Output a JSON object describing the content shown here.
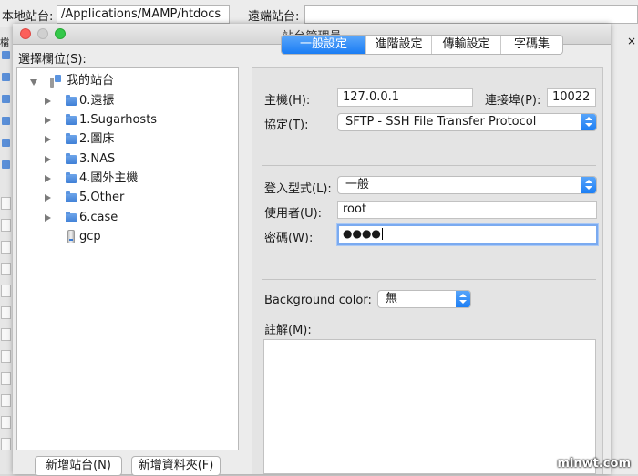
{
  "background": {
    "local_site_label": "本地站台:",
    "local_site_path": "/Applications/MAMP/htdocs",
    "remote_site_label": "遠端站台:",
    "remote_site_path": "",
    "left_cut_label": "檔",
    "right_close_glyph": "×"
  },
  "window": {
    "title": "站台管理員"
  },
  "site_selector": {
    "label": "選擇欄位(S):",
    "root": "我的站台",
    "folders": [
      "0.遠振",
      "1.Sugarhosts",
      "2.圖床",
      "3.NAS",
      "4.國外主機",
      "5.Other",
      "6.case"
    ],
    "site": "gcp",
    "new_site_button": "新增站台(N)",
    "new_folder_button": "新增資料夾(F)"
  },
  "tabs": [
    {
      "label": "一般設定",
      "active": true
    },
    {
      "label": "進階設定",
      "active": false
    },
    {
      "label": "傳輸設定",
      "active": false
    },
    {
      "label": "字碼集",
      "active": false
    }
  ],
  "general": {
    "host_label": "主機(H):",
    "host_value": "127.0.0.1",
    "port_label": "連接埠(P):",
    "port_value": "10022",
    "protocol_label": "協定(T):",
    "protocol_value": "SFTP - SSH File Transfer Protocol",
    "logon_type_label": "登入型式(L):",
    "logon_type_value": "一般",
    "user_label": "使用者(U):",
    "user_value": "root",
    "password_label": "密碼(W):",
    "password_masked": "●●●●",
    "bg_color_label": "Background color:",
    "bg_color_value": "無",
    "comments_label": "註解(M):"
  },
  "watermark": "minwt.com",
  "colors": {
    "accent_blue": "#1a7df4",
    "folder_blue": "#5b94e0",
    "traffic_red": "#fc605b",
    "traffic_green": "#34c84a"
  }
}
